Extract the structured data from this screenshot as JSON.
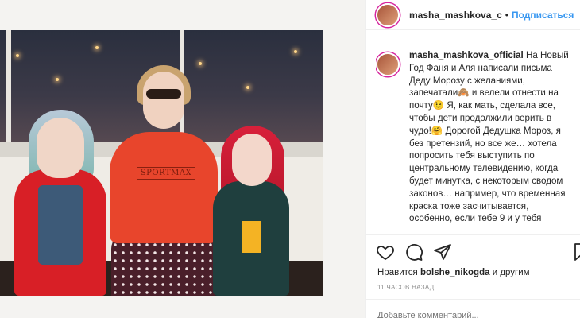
{
  "post": {
    "header": {
      "username": "masha_mashkova_c",
      "separator": "•",
      "follow_label": "Подписаться"
    },
    "caption": {
      "username": "masha_mashkova_official",
      "text": "На Новый Год Фаня и Аля написали письма Деду Морозу с желаниями, запечатали🙈 и велели отнести на почту😉 Я, как мать, сделала все, чтобы дети продолжили верить в чудо!🤗 Дорогой Дедушка Мороз, я без претензий, но все же… хотела попросить тебя выступить по центральному телевидению, когда будет минутка, с некоторым сводом законов… например, что временная краска тоже засчитывается, особенно, если тебе 9 и у тебя"
    },
    "photo": {
      "shirt_print": "SPORTMAX"
    },
    "likes": {
      "prefix": "Нравится",
      "user": "bolshe_nikogda",
      "suffix": "и другим"
    },
    "timestamp": "11 часов назад",
    "comment_placeholder": "Добавьте комментарий..."
  },
  "icons": {
    "like": "heart-icon",
    "comment": "comment-icon",
    "share": "share-icon",
    "save": "bookmark-icon"
  },
  "colors": {
    "link_blue": "#3897f0",
    "text": "#262626",
    "muted": "#8e8e8e",
    "border": "#efefef"
  }
}
